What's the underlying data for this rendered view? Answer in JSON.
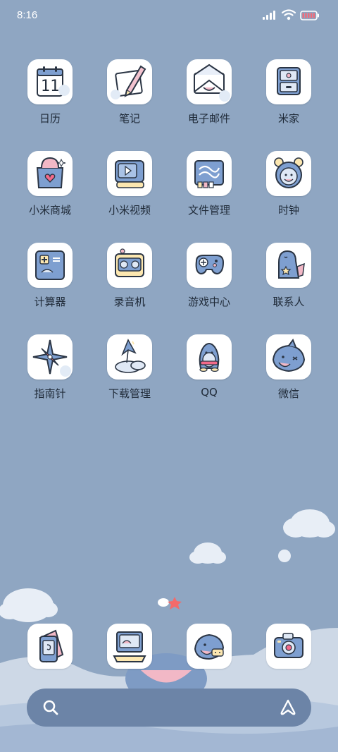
{
  "status_bar": {
    "time": "8:16",
    "icons": [
      "signal-icon",
      "wifi-icon",
      "battery-icon"
    ]
  },
  "apps": [
    {
      "label": "日历",
      "icon": "calendar-icon",
      "date": "11"
    },
    {
      "label": "笔记",
      "icon": "notes-icon"
    },
    {
      "label": "电子邮件",
      "icon": "mail-icon"
    },
    {
      "label": "米家",
      "icon": "home-cabinet-icon"
    },
    {
      "label": "小米商城",
      "icon": "shopping-bag-icon"
    },
    {
      "label": "小米视频",
      "icon": "video-player-icon"
    },
    {
      "label": "文件管理",
      "icon": "folder-icon"
    },
    {
      "label": "时钟",
      "icon": "alarm-clock-icon"
    },
    {
      "label": "计算器",
      "icon": "calculator-icon"
    },
    {
      "label": "录音机",
      "icon": "recorder-icon"
    },
    {
      "label": "游戏中心",
      "icon": "gamepad-icon"
    },
    {
      "label": "联系人",
      "icon": "contacts-icon"
    },
    {
      "label": "指南针",
      "icon": "compass-icon"
    },
    {
      "label": "下载管理",
      "icon": "download-icon"
    },
    {
      "label": "QQ",
      "icon": "qq-penguin-icon"
    },
    {
      "label": "微信",
      "icon": "wechat-shark-icon"
    }
  ],
  "dock": [
    {
      "name": "phone-icon"
    },
    {
      "name": "computer-icon"
    },
    {
      "name": "messages-icon"
    },
    {
      "name": "camera-icon"
    }
  ],
  "search": {
    "left_icon": "search-icon",
    "right_icon": "assistant-icon"
  },
  "colors": {
    "wallpaper": "#8fa6c2",
    "icon_bg": "#ffffff",
    "search_bar": "#6c84a7",
    "battery": "#f16a78"
  }
}
